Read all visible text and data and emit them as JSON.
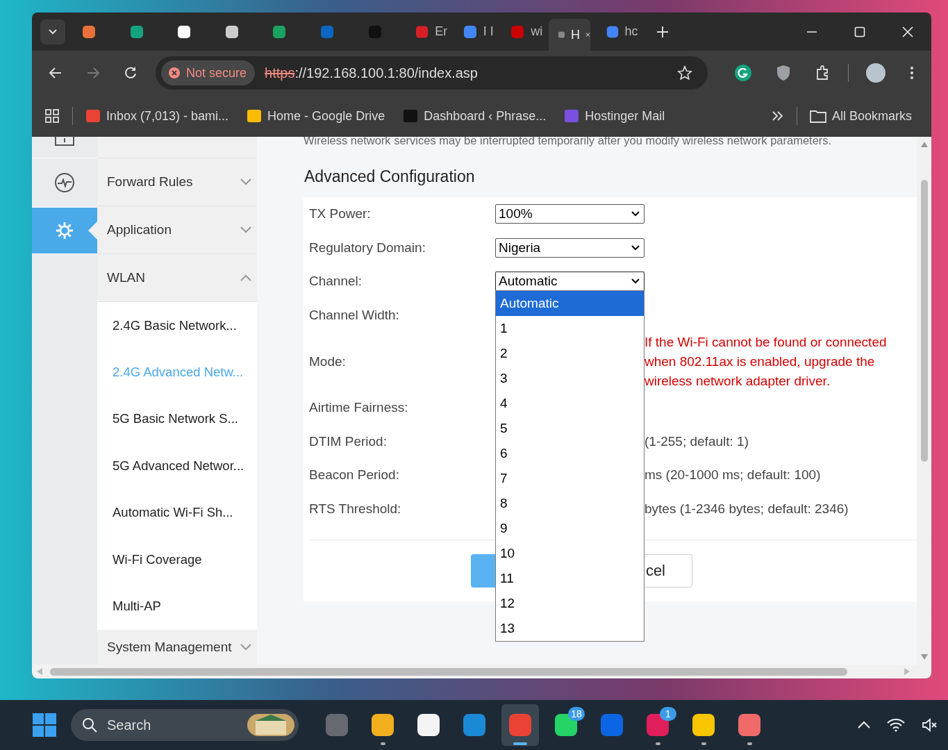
{
  "browser": {
    "tabs": [
      {
        "selected": false
      },
      {
        "selected": false
      },
      {
        "selected": false
      },
      {
        "selected": false
      },
      {
        "selected": false
      },
      {
        "selected": false
      },
      {
        "selected": false
      },
      {
        "title": "Er",
        "selected": false
      },
      {
        "title": "I I",
        "selected": false
      },
      {
        "title": "wi",
        "selected": false
      },
      {
        "title": "H",
        "selected": true
      },
      {
        "title": "hc",
        "selected": false
      }
    ],
    "security_label": "Not secure",
    "url_scheme": "https",
    "url_rest": "://192.168.100.1:80/index.asp",
    "bookmarks": [
      "Inbox (7,013) - bami...",
      "Home - Google Drive",
      "Dashboard ‹ Phrase...",
      "Hostinger Mail"
    ],
    "all_bookmarks": "All Bookmarks"
  },
  "sidebar": {
    "rail": [
      {
        "selected": false
      },
      {
        "selected": false
      },
      {
        "selected": true
      }
    ],
    "menu": [
      {
        "label": "Forward Rules",
        "expanded": false
      },
      {
        "label": "Application",
        "expanded": false
      },
      {
        "label": "WLAN",
        "expanded": true,
        "children": [
          {
            "label": "2.4G Basic Network...",
            "selected": false
          },
          {
            "label": "2.4G Advanced Netw...",
            "selected": true
          },
          {
            "label": "5G Basic Network S...",
            "selected": false
          },
          {
            "label": "5G Advanced Networ...",
            "selected": false
          },
          {
            "label": "Automatic Wi-Fi Sh...",
            "selected": false
          },
          {
            "label": "Wi-Fi Coverage",
            "selected": false
          },
          {
            "label": "Multi-AP",
            "selected": false
          }
        ]
      },
      {
        "label": "System Management",
        "expanded": false
      }
    ]
  },
  "main": {
    "notice": "Wireless network services may be interrupted temporarily after you modify wireless network parameters.",
    "heading": "Advanced Configuration",
    "fields": [
      {
        "label": "TX Power:",
        "kind": "select",
        "value": "100%"
      },
      {
        "label": "Regulatory Domain:",
        "kind": "select",
        "value": "Nigeria"
      },
      {
        "label": "Channel:",
        "kind": "select",
        "value": "Automatic",
        "expanded": true,
        "options": [
          {
            "label": "Automatic",
            "selected": true
          },
          {
            "label": "1",
            "selected": false
          },
          {
            "label": "2",
            "selected": false
          },
          {
            "label": "3",
            "selected": false
          },
          {
            "label": "4",
            "selected": false
          },
          {
            "label": "5",
            "selected": false
          },
          {
            "label": "6",
            "selected": false
          },
          {
            "label": "7",
            "selected": false
          },
          {
            "label": "8",
            "selected": false
          },
          {
            "label": "9",
            "selected": false
          },
          {
            "label": "10",
            "selected": false
          },
          {
            "label": "11",
            "selected": false
          },
          {
            "label": "12",
            "selected": false
          },
          {
            "label": "13",
            "selected": false
          }
        ]
      },
      {
        "label": "Channel Width:",
        "kind": "covered"
      },
      {
        "label": "Mode:",
        "kind": "covered",
        "note": "If the Wi-Fi cannot be found or connected when 802.11ax is enabled, upgrade the wireless network adapter driver."
      },
      {
        "label": "Airtime Fairness:",
        "kind": "covered"
      },
      {
        "label": "DTIM Period:",
        "kind": "input",
        "hint": "(1-255; default: 1)"
      },
      {
        "label": "Beacon Period:",
        "kind": "input",
        "hint": "ms (20-1000 ms; default: 100)"
      },
      {
        "label": "RTS Threshold:",
        "kind": "input",
        "hint": "bytes (1-2346 bytes; default: 2346)"
      }
    ],
    "buttons": [
      {
        "kind": "primary"
      },
      {
        "kind": "secondary",
        "label": "cel"
      }
    ]
  },
  "taskbar": {
    "search_placeholder": "Search",
    "apps": [
      {
        "selected": false,
        "running": false
      },
      {
        "selected": false,
        "running": true
      },
      {
        "selected": false,
        "running": false
      },
      {
        "selected": false,
        "running": false
      },
      {
        "selected": true,
        "running": true
      },
      {
        "selected": false,
        "running": false,
        "badge": "18"
      },
      {
        "selected": false,
        "running": false
      },
      {
        "selected": false,
        "running": true,
        "badge": "1"
      },
      {
        "selected": false,
        "running": true
      },
      {
        "selected": false,
        "running": true
      }
    ]
  }
}
